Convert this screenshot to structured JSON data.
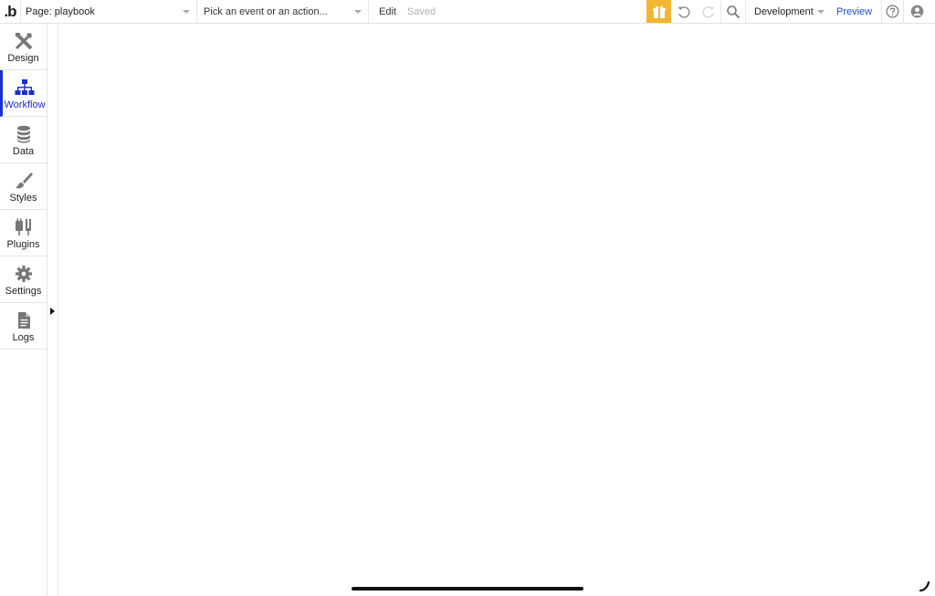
{
  "topbar": {
    "logo_text": ".b",
    "page_label": "Page: playbook",
    "event_placeholder": "Pick an event or an action...",
    "edit_label": "Edit",
    "saved_label": "Saved",
    "environment": "Development",
    "preview_label": "Preview",
    "accent_color": "#f2b632"
  },
  "sidebar": {
    "active_color": "#1a2fd0",
    "items": [
      {
        "label": "Design",
        "icon": "design-tools-icon"
      },
      {
        "label": "Workflow",
        "icon": "workflow-tree-icon",
        "active": true
      },
      {
        "label": "Data",
        "icon": "database-icon"
      },
      {
        "label": "Styles",
        "icon": "paintbrush-icon"
      },
      {
        "label": "Plugins",
        "icon": "plug-icon"
      },
      {
        "label": "Settings",
        "icon": "gear-icon"
      },
      {
        "label": "Logs",
        "icon": "document-icon"
      }
    ]
  }
}
